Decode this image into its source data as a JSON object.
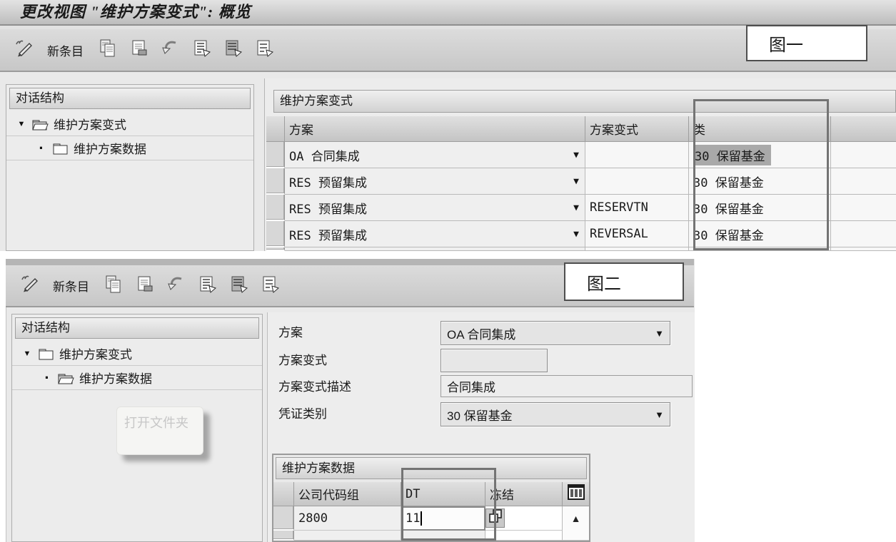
{
  "fig1": {
    "label": "图一",
    "title": "更改视图 \"维护方案变式\": 概览",
    "toolbar": {
      "new_entries": "新条目"
    },
    "tree": {
      "header": "对话结构",
      "node1": "维护方案变式",
      "node2": "维护方案数据"
    },
    "panel_title": "维护方案变式",
    "columns": {
      "plan": "方案",
      "variant": "方案变式",
      "category": "类"
    },
    "rows": [
      {
        "plan": "OA 合同集成",
        "variant": "",
        "category": "30 保留基金"
      },
      {
        "plan": "RES 预留集成",
        "variant": "",
        "category": "30 保留基金"
      },
      {
        "plan": "RES 预留集成",
        "variant": "RESERVTN",
        "category": "30 保留基金"
      },
      {
        "plan": "RES 预留集成",
        "variant": "REVERSAL",
        "category": "30 保留基金"
      }
    ]
  },
  "fig2": {
    "label": "图二",
    "toolbar": {
      "new_entries": "新条目"
    },
    "tree": {
      "header": "对话结构",
      "node1": "维护方案变式",
      "node2": "维护方案数据",
      "tooltip": "打开文件夹"
    },
    "form": {
      "plan_label": "方案",
      "plan_value": "OA 合同集成",
      "variant_label": "方案变式",
      "variant_value": "",
      "desc_label": "方案变式描述",
      "desc_value": "合同集成",
      "doctype_label": "凭证类别",
      "doctype_value": "30 保留基金"
    },
    "table": {
      "title": "维护方案数据",
      "columns": {
        "ccg": "公司代码组",
        "dt": "DT",
        "freeze": "冻结"
      },
      "row": {
        "ccg": "2800",
        "dt": "11",
        "freeze": ""
      }
    }
  },
  "icons": [
    "pencil-glasses-icon",
    "copy-icon",
    "copy-as-icon",
    "undo-icon",
    "doc-arrow-icon",
    "doc-arrow-dark-icon",
    "doc-arrow-light-icon",
    "open-folder-icon",
    "closed-folder-icon",
    "dropdown-arrow-icon",
    "table-settings-icon",
    "overlap-docs-icon",
    "scroll-up-arrow-icon"
  ]
}
